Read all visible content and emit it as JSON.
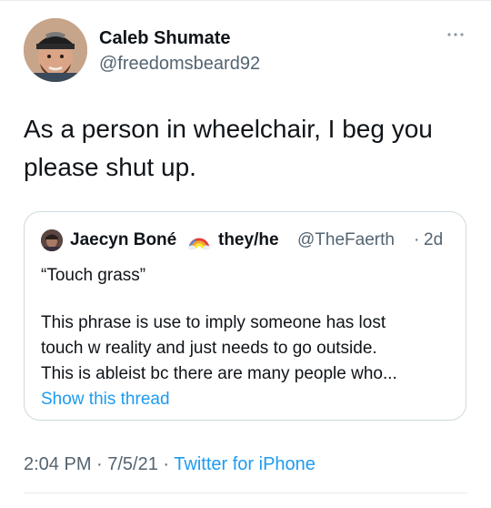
{
  "tweet": {
    "author_name": "Caleb Shumate",
    "author_handle": "@freedomsbeard92",
    "text": "As a person in wheelchair, I beg you please shut up.",
    "timestamp": "2:04 PM · 7/5/21 ·",
    "source": "Twitter for iPhone"
  },
  "quoted": {
    "author_name": "Jaecyn Boné",
    "rainbow_icon": "rainbow-icon",
    "pronouns": "they/he",
    "handle": "@TheFaerth",
    "dot": "·",
    "time": "2d",
    "title": "“Touch grass”",
    "body_lines": [
      "This phrase is use to imply someone has lost",
      "touch w reality and just needs to go outside.",
      "This is ableist bc there are many people who..."
    ],
    "show_thread": "Show this thread"
  },
  "icons": {
    "more": "more-options-icon",
    "avatar": "avatar",
    "quoted_avatar": "avatar"
  },
  "colors": {
    "link": "#1d9bf0",
    "secondary_text": "#536471",
    "primary_text": "#0f1419",
    "border": "#cfd9de"
  }
}
